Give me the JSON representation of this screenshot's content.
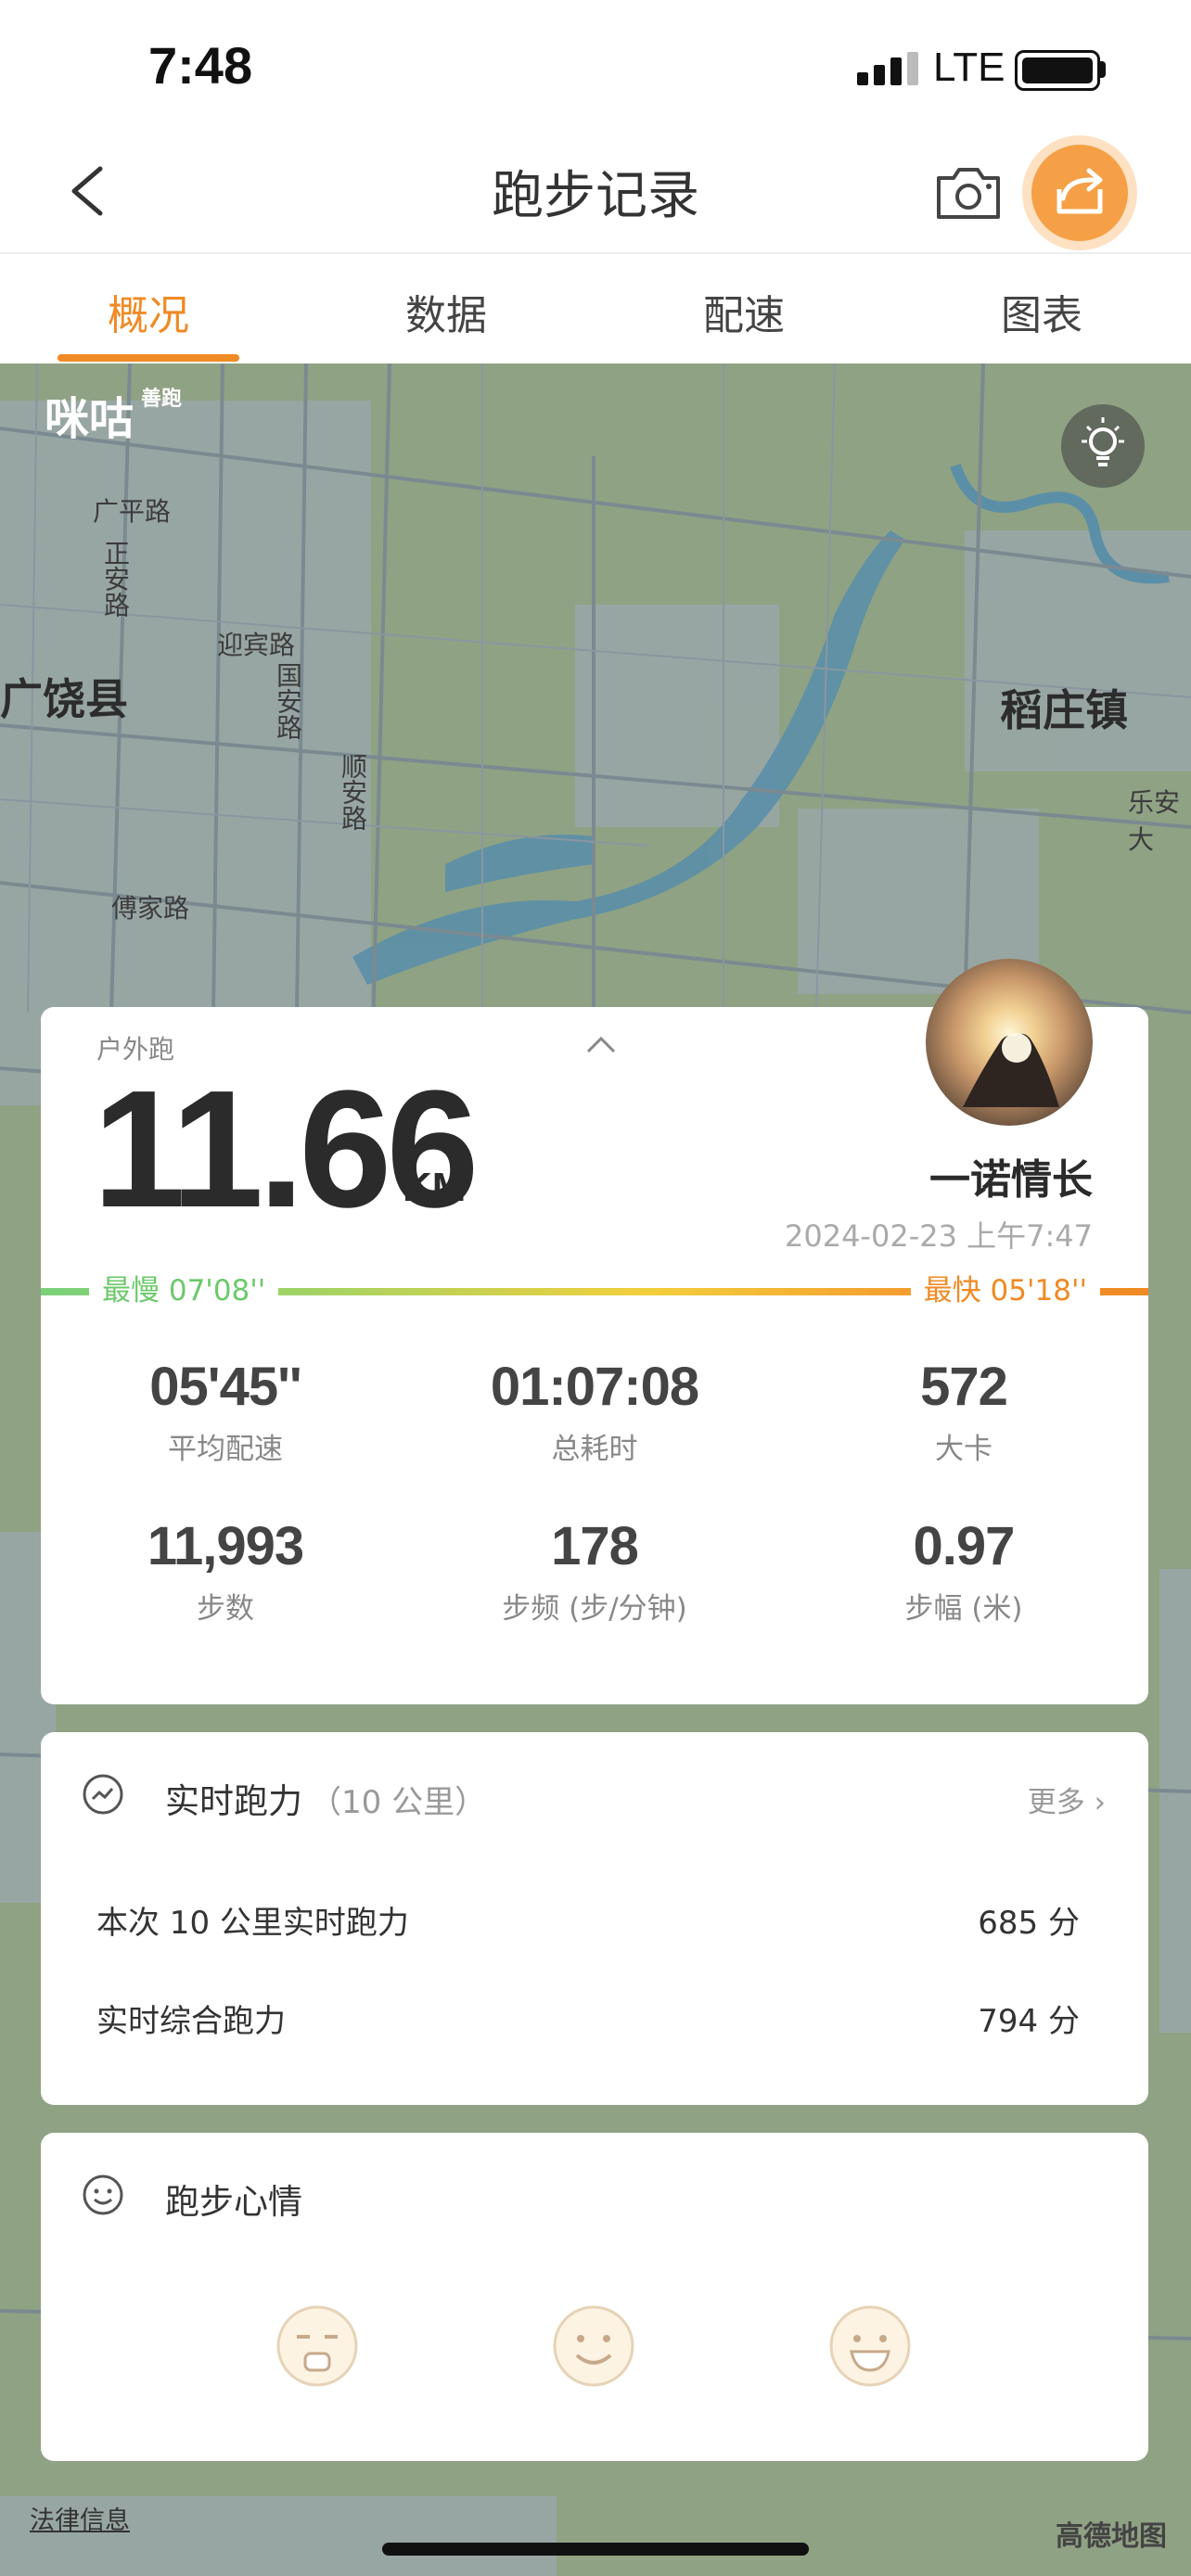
{
  "status_bar": {
    "time": "7:48",
    "network": "LTE"
  },
  "nav": {
    "title": "跑步记录"
  },
  "tabs": [
    {
      "label": "概况",
      "active": true
    },
    {
      "label": "数据",
      "active": false
    },
    {
      "label": "配速",
      "active": false
    },
    {
      "label": "图表",
      "active": false
    }
  ],
  "map": {
    "logo": "咪咕",
    "logo_small": "善跑",
    "labels": {
      "county": "广饶县",
      "town": "稻庄镇",
      "road1": "广平路",
      "road2": "正安路",
      "road3": "迎宾路",
      "road4": "国安路",
      "road5": "顺安路",
      "road6": "傅家路",
      "road7": "乐安大"
    },
    "attribution": "高德地图",
    "legal": "法律信息",
    "colors": {
      "land": "#8fa284",
      "urban": "#9aa7a8",
      "water": "#5b8fa8",
      "road": "#7b8a90"
    }
  },
  "summary": {
    "run_type": "户外跑",
    "distance": "11.66",
    "unit": "KM",
    "user": "一诺情长",
    "datetime": "2024-02-23 上午7:47",
    "pace_slowest": "最慢  07'08''",
    "pace_fastest": "最快  05'18''",
    "stats": [
      {
        "value": "05'45''",
        "label": "平均配速"
      },
      {
        "value": "01:07:08",
        "label": "总耗时"
      },
      {
        "value": "572",
        "label": "大卡"
      },
      {
        "value": "11,993",
        "label": "步数"
      },
      {
        "value": "178",
        "label": "步频 (步/分钟)"
      },
      {
        "value": "0.97",
        "label": "步幅 (米)"
      }
    ]
  },
  "power": {
    "title": "实时跑力",
    "subtitle": "（10 公里）",
    "more": "更多",
    "rows": [
      {
        "label": "本次 10 公里实时跑力",
        "value": "685 分"
      },
      {
        "label": "实时综合跑力",
        "value": "794 分"
      }
    ]
  },
  "mood": {
    "title": "跑步心情"
  },
  "accent_color": "#f08a24"
}
